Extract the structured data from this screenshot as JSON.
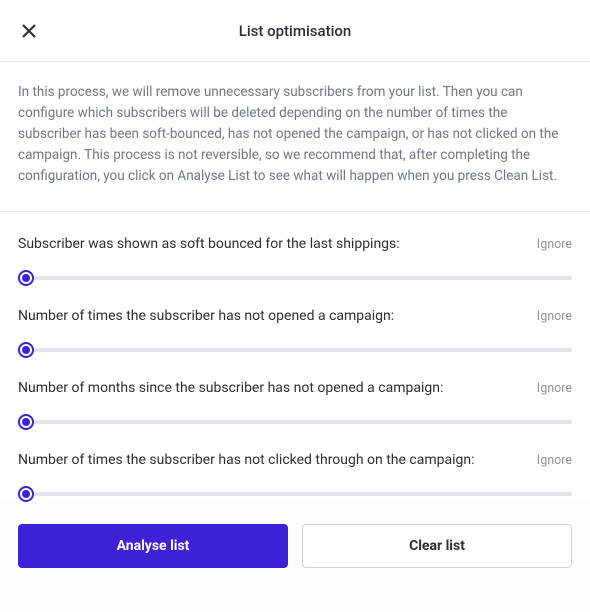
{
  "header": {
    "title": "List optimisation"
  },
  "description": "In this process, we will remove unnecessary subscribers from your list. Then you can configure which subscribers will be deleted depending on the number of times the subscriber has been soft-bounced, has not opened the campaign, or has not clicked on the campaign. This process is not reversible, so we recommend that, after completing the configuration, you click on Analyse List to see what will happen when you press Clean List.",
  "rows": [
    {
      "label": "Subscriber was shown as soft bounced for the last shippings:",
      "action": "Ignore",
      "value": 0
    },
    {
      "label": "Number of times the subscriber has not opened a campaign:",
      "action": "Ignore",
      "value": 0
    },
    {
      "label": "Number of months since the subscriber has not opened a campaign:",
      "action": "Ignore",
      "value": 0
    },
    {
      "label": "Number of times the subscriber has not clicked through on the campaign:",
      "action": "Ignore",
      "value": 0
    }
  ],
  "buttons": {
    "primary": "Analyse list",
    "secondary": "Clear list"
  }
}
